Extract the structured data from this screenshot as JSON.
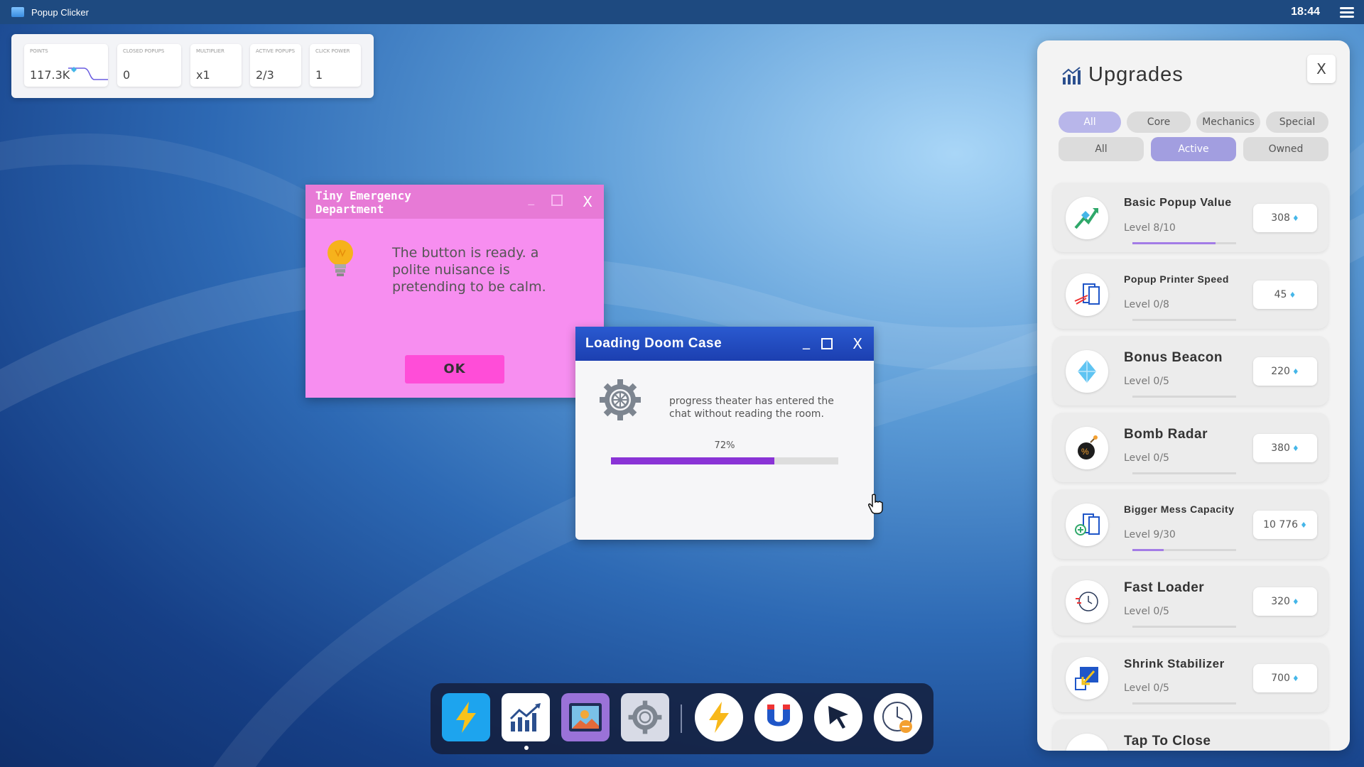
{
  "app": {
    "title": "Popup Clicker",
    "clock": "18:44"
  },
  "stats": [
    {
      "label": "POINTS",
      "value": "117.3K"
    },
    {
      "label": "CLOSED POPUPS",
      "value": "0"
    },
    {
      "label": "MULTIPLIER",
      "value": "x1"
    },
    {
      "label": "ACTIVE POPUPS",
      "value": "2/3"
    },
    {
      "label": "CLICK POWER",
      "value": "1"
    }
  ],
  "popup_pink": {
    "title": "Tiny Emergency Department",
    "message": "The button is ready. a polite nuisance is pretending to be calm.",
    "ok_label": "OK",
    "min_label": "_",
    "close_label": "X",
    "icon": "lightbulb-icon"
  },
  "popup_blue": {
    "title": "Loading Doom Case",
    "message": "progress theater has entered the chat without reading the room.",
    "progress_text": "72%",
    "progress": 0.72,
    "min_label": "_",
    "close_label": "X",
    "icon": "gear-icon"
  },
  "dock": {
    "items": [
      "lightning-app-icon",
      "chart-app-icon",
      "picture-app-icon",
      "settings-app-icon",
      "lightning-icon",
      "magnet-icon",
      "cursor-icon",
      "clock-icon"
    ]
  },
  "upgrades": {
    "title": "Upgrades",
    "close_label": "X",
    "category_tabs": [
      "All",
      "Core",
      "Mechanics",
      "Special"
    ],
    "active_category": "All",
    "status_tabs": [
      "All",
      "Active",
      "Owned"
    ],
    "active_status": "Active",
    "items": [
      {
        "name": "Basic Popup Value",
        "level": "Level 8/10",
        "price": "308",
        "progress": 0.8,
        "icon": "trending-up-icon"
      },
      {
        "name": "Popup Printer Speed",
        "level": "Level 0/8",
        "price": "45",
        "progress": 0,
        "icon": "printer-speed-icon"
      },
      {
        "name": "Bonus Beacon",
        "level": "Level 0/5",
        "price": "220",
        "progress": 0,
        "icon": "diamond-icon"
      },
      {
        "name": "Bomb Radar",
        "level": "Level 0/5",
        "price": "380",
        "progress": 0,
        "icon": "bomb-icon"
      },
      {
        "name": "Bigger Mess Capacity",
        "level": "Level 9/30",
        "price": "10 776",
        "progress": 0.3,
        "icon": "window-add-icon"
      },
      {
        "name": "Fast Loader",
        "level": "Level 0/5",
        "price": "320",
        "progress": 0,
        "icon": "fast-clock-icon"
      },
      {
        "name": "Shrink Stabilizer",
        "level": "Level 0/5",
        "price": "700",
        "progress": 0,
        "icon": "shrink-arrow-icon"
      },
      {
        "name": "Tap To Close",
        "level": "",
        "price": "",
        "progress": 0,
        "icon": "tap-icon"
      }
    ]
  },
  "colors": {
    "accent": "#a29ee0",
    "pink": "#f78ef0",
    "blue_title": "#2a5ad0",
    "progress": "#8a33d6"
  }
}
